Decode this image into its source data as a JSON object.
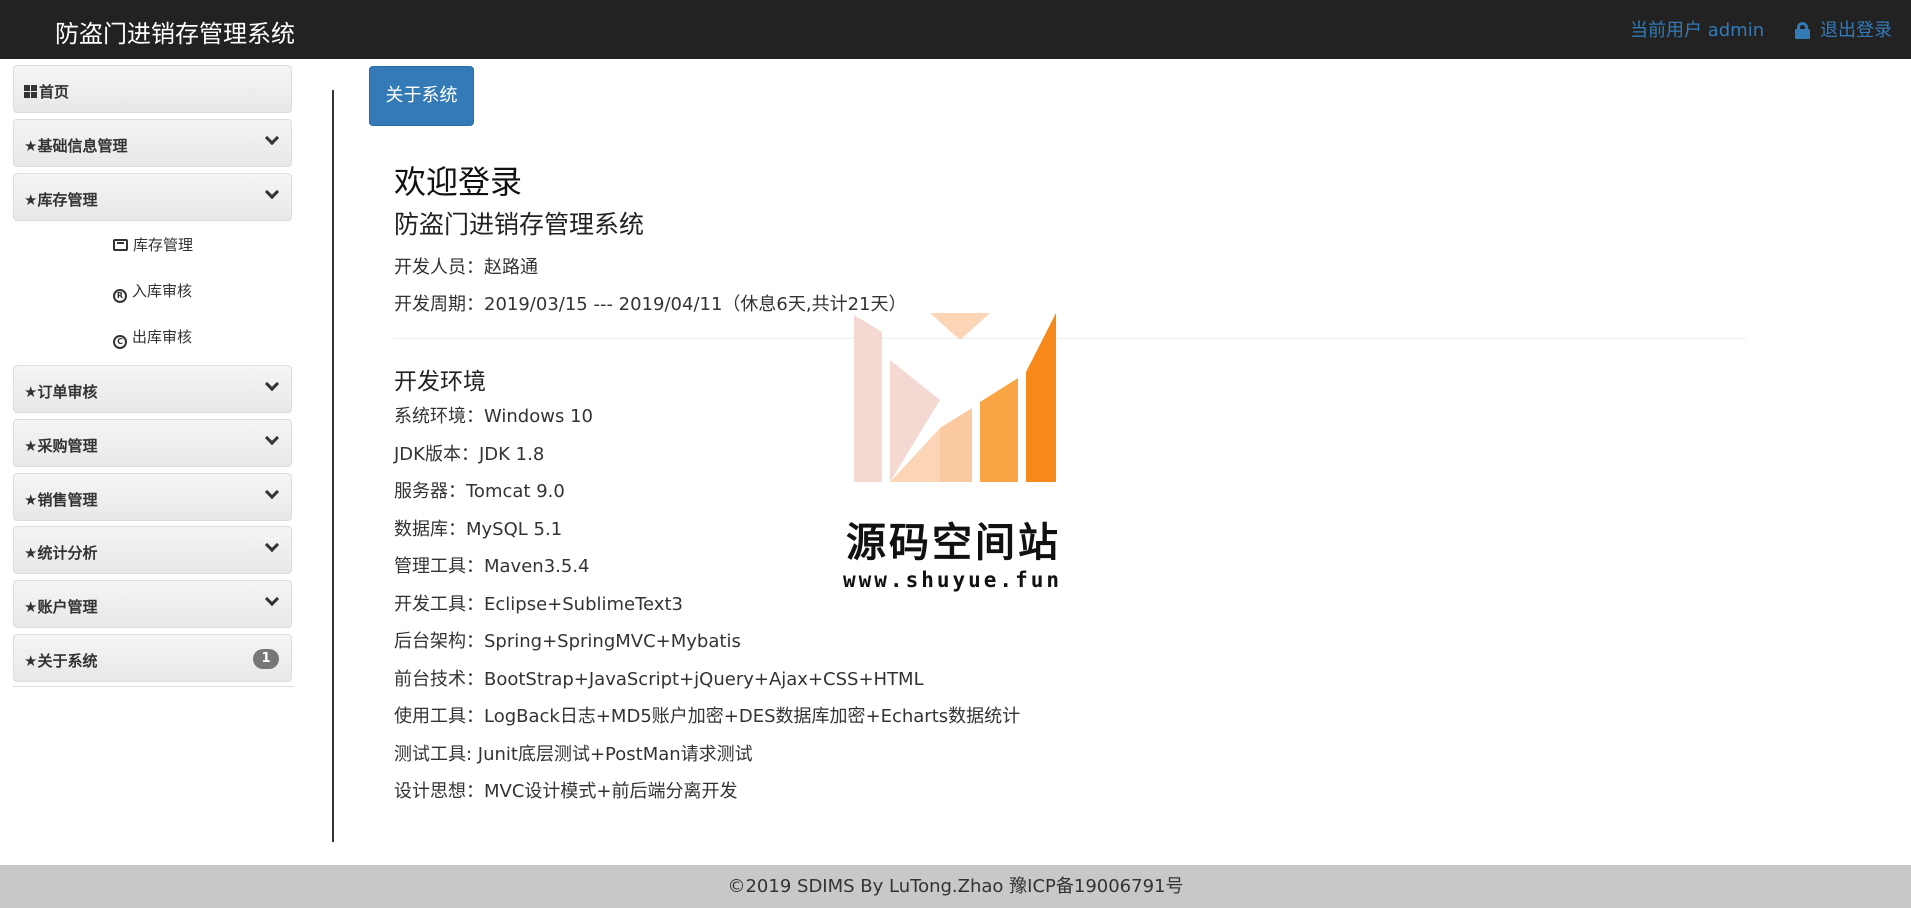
{
  "navbar": {
    "brand": "防盗门进销存管理系统",
    "current_user": "当前用户 admin",
    "logout": "退出登录"
  },
  "sidebar": {
    "items": [
      {
        "label": "首页"
      },
      {
        "label": "★基础信息管理"
      },
      {
        "label": "★库存管理"
      },
      {
        "label": "★订单审核"
      },
      {
        "label": "★采购管理"
      },
      {
        "label": "★销售管理"
      },
      {
        "label": "★统计分析"
      },
      {
        "label": "★账户管理"
      },
      {
        "label": "★关于系统",
        "badge": "1"
      }
    ],
    "sub_items": [
      {
        "label": "库存管理"
      },
      {
        "label": "入库审核"
      },
      {
        "label": "出库审核"
      }
    ]
  },
  "main": {
    "tab_button": "关于系统",
    "welcome": "欢迎登录",
    "system_name": "防盗门进销存管理系统",
    "developer": "开发人员：赵路通",
    "period": "开发周期：2019/03/15 --- 2019/04/11（休息6天,共计21天）",
    "env_title": "开发环境",
    "env_lines": [
      "系统环境：Windows 10",
      "JDK版本：JDK 1.8",
      "服务器：Tomcat 9.0",
      "数据库：MySQL 5.1",
      "管理工具：Maven3.5.4",
      "开发工具：Eclipse+SublimeText3",
      "后台架构：Spring+SpringMVC+Mybatis",
      "前台技术：BootStrap+JavaScript+jQuery+Ajax+CSS+HTML",
      "使用工具：LogBack日志+MD5账户加密+DES数据库加密+Echarts数据统计",
      "测试工具: Junit底层测试+PostMan请求测试",
      "设计思想：MVC设计模式+前后端分离开发"
    ]
  },
  "watermark": {
    "name": "源码空间站",
    "url": "www.shuyue.fun",
    "colors": [
      "#f4d9d3",
      "#fbc9a0",
      "#f9a545",
      "#f7881a"
    ]
  },
  "footer": {
    "text": "©2019 SDIMS By LuTong.Zhao 豫ICP备19006791号"
  }
}
